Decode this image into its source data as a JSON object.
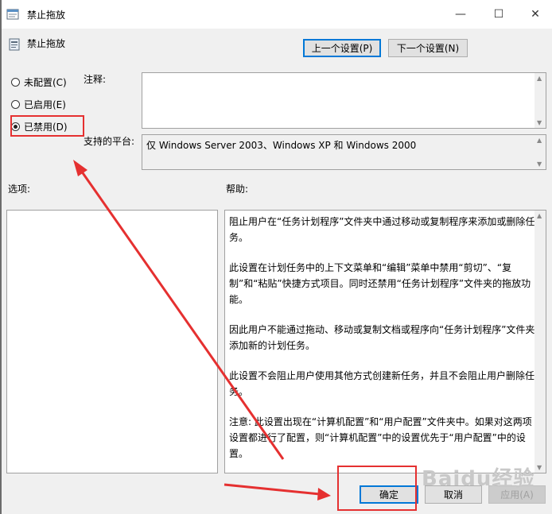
{
  "window": {
    "title": "禁止拖放",
    "minimize_glyph": "—",
    "maximize_glyph": "☐",
    "close_glyph": "✕"
  },
  "policy": {
    "name": "禁止拖放"
  },
  "nav": {
    "prev_label": "上一个设置(P)",
    "next_label": "下一个设置(N)"
  },
  "state": {
    "options": [
      {
        "label": "未配置(C)",
        "checked": false
      },
      {
        "label": "已启用(E)",
        "checked": false
      },
      {
        "label": "已禁用(D)",
        "checked": true
      }
    ]
  },
  "comment": {
    "label": "注释:",
    "value": ""
  },
  "platform": {
    "label": "支持的平台:",
    "value": "仅 Windows Server 2003、Windows XP 和 Windows 2000"
  },
  "options_section": {
    "label": "选项:"
  },
  "help": {
    "label": "帮助:",
    "paragraphs": [
      "阻止用户在“任务计划程序”文件夹中通过移动或复制程序来添加或删除任务。",
      "此设置在计划任务中的上下文菜单和“编辑”菜单中禁用“剪切”、“复制”和“粘贴”快捷方式项目。同时还禁用“任务计划程序”文件夹的拖放功能。",
      "因此用户不能通过拖动、移动或复制文档或程序向“任务计划程序”文件夹添加新的计划任务。",
      "此设置不会阻止用户使用其他方式创建新任务，并且不会阻止用户删除任务。",
      "注意: 此设置出现在“计算机配置”和“用户配置”文件夹中。如果对这两项设置都进行了配置，则“计算机配置”中的设置优先于“用户配置”中的设置。"
    ]
  },
  "footer": {
    "ok_label": "确定",
    "cancel_label": "取消",
    "apply_label": "应用(A)"
  },
  "watermark": {
    "text": "Baidu经验"
  },
  "colors": {
    "annotation_red": "#e53030",
    "accent": "#0078d7"
  }
}
